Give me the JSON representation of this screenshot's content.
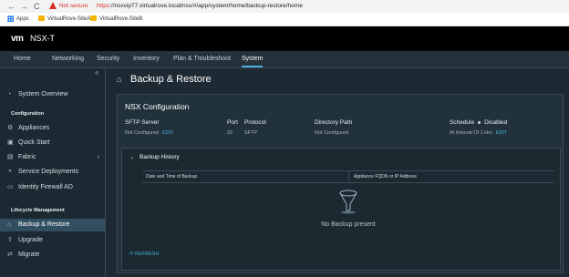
{
  "browser": {
    "back": "←",
    "forward": "→",
    "reload": "C",
    "not_secure": "Not secure",
    "url_https": "https",
    "url_rest": "://nsxvip77.virtualrove.local/nsx/#/app/system/home/backup-restore/home",
    "bookmarks": [
      "Apps",
      "VirtualRove-SiteA",
      "VirtualRove-SiteB"
    ]
  },
  "header": {
    "logo": "vm",
    "product": "NSX-T"
  },
  "tabs": [
    "Home",
    "Networking",
    "Security",
    "Inventory",
    "Plan & Troubleshoot",
    "System"
  ],
  "active_tab": "System",
  "sidebar": {
    "collapse": "«",
    "items": [
      {
        "label": "System Overview",
        "icon": "dashboard-icon"
      },
      {
        "group": "Configuration"
      },
      {
        "label": "Appliances",
        "icon": "appliances-icon"
      },
      {
        "label": "Quick Start",
        "icon": "quick-start-icon"
      },
      {
        "label": "Fabric",
        "icon": "fabric-icon",
        "expandable": true
      },
      {
        "label": "Service Deployments",
        "icon": "service-icon"
      },
      {
        "label": "Identity Firewall AD",
        "icon": "identity-icon"
      },
      {
        "group": "Lifecycle Management"
      },
      {
        "label": "Backup & Restore",
        "icon": "backup-icon",
        "selected": true
      },
      {
        "label": "Upgrade",
        "icon": "upgrade-icon"
      },
      {
        "label": "Migrate",
        "icon": "migrate-icon"
      }
    ]
  },
  "page": {
    "title": "Backup & Restore"
  },
  "config": {
    "title": "NSX Configuration",
    "sftp_label": "SFTP Server",
    "sftp_value": "Not Configured",
    "edit": "EDIT",
    "port_label": "Port",
    "port_value": "22",
    "protocol_label": "Protocol",
    "protocol_value": "SFTP",
    "directory_label": "Directory Path",
    "directory_value": "Not Configured",
    "schedule_label": "Schedule",
    "schedule_status": "Disabled",
    "schedule_value": "At Interval Of 1 Hrs",
    "schedule_edit": "EDIT"
  },
  "history": {
    "title": "Backup History",
    "columns": [
      "Date and Time of Backup",
      "Appliance FQDN or IP Address"
    ],
    "empty": "No Backup present",
    "refresh": "REFRESH"
  },
  "colors": {
    "accent": "#49afd9",
    "header": "#000000",
    "background": "#1e2a33"
  }
}
